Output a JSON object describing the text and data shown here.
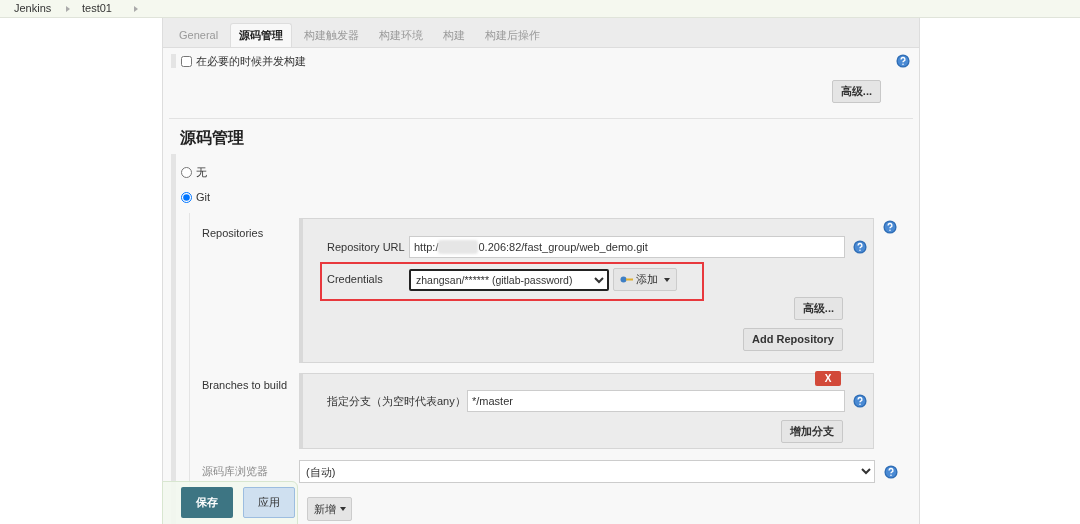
{
  "breadcrumb": [
    "Jenkins",
    "test01"
  ],
  "tabs": [
    {
      "label": "General",
      "selected": false
    },
    {
      "label": "源码管理",
      "selected": true
    },
    {
      "label": "构建触发器",
      "selected": false
    },
    {
      "label": "构建环境",
      "selected": false
    },
    {
      "label": "构建",
      "selected": false
    },
    {
      "label": "构建后操作",
      "selected": false
    }
  ],
  "concurrent_build": {
    "label": "在必要的时候并发构建",
    "checked": false
  },
  "advanced_button": "高级...",
  "section_title": "源码管理",
  "scm_options": [
    {
      "label": "无",
      "selected": false
    },
    {
      "label": "Git",
      "selected": true
    }
  ],
  "repositories": {
    "label": "Repositories",
    "url_label": "Repository URL",
    "url_prefix": "http:/",
    "url_suffix": "0.206:82/fast_group/web_demo.git",
    "credentials_label": "Credentials",
    "credentials_value": "zhangsan/****** (gitlab-password)",
    "add_button": "添加",
    "advanced_button": "高级...",
    "add_repository_button": "Add Repository"
  },
  "branches": {
    "label": "Branches to build",
    "delete_button": "X",
    "branch_label": "指定分支（为空时代表any）",
    "branch_value": "*/master",
    "add_branch_button": "增加分支"
  },
  "browser": {
    "label": "源码库浏览器",
    "value": "(自动)"
  },
  "new_button": "新增",
  "save_bar": {
    "save": "保存",
    "apply": "应用"
  }
}
